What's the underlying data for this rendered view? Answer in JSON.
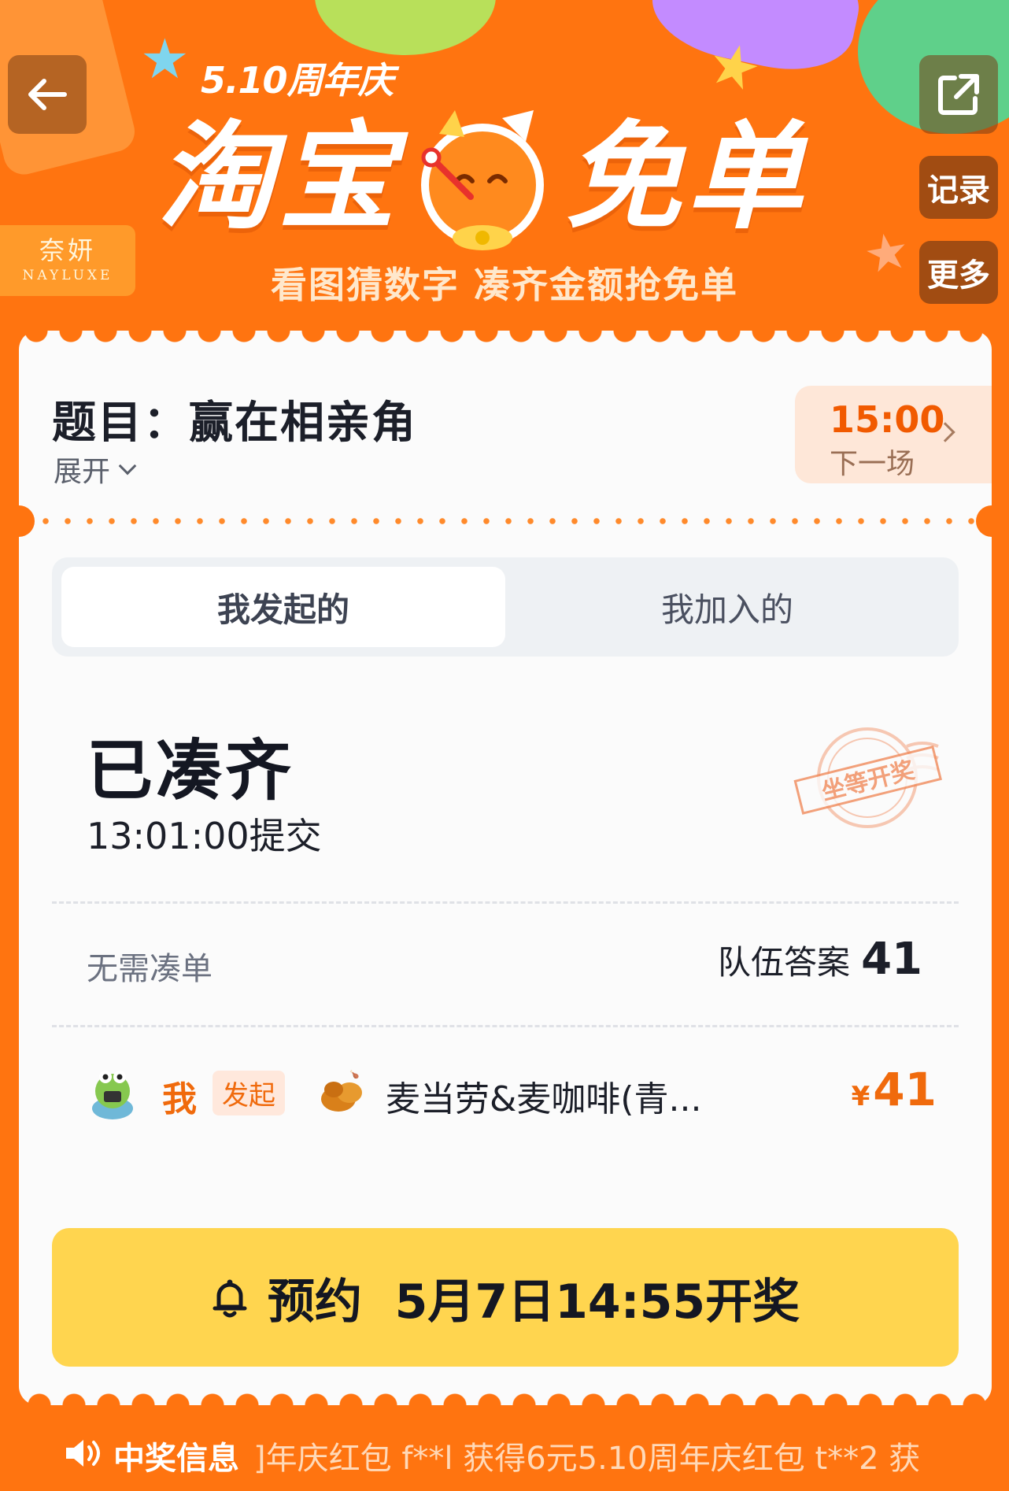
{
  "header": {
    "event_tag": "5.10周年庆",
    "title_left": "淘宝",
    "title_right": "免单",
    "subtitle": "看图猜数字 凑齐金额抢免单",
    "brand_cn": "奈妍",
    "brand_en": "NAYLUXE",
    "records_label": "记录",
    "more_label": "更多",
    "back_icon": "back-arrow-icon",
    "share_icon": "share-icon"
  },
  "question": {
    "title": "题目：赢在相亲角",
    "expand_label": "展开"
  },
  "next_session": {
    "time": "15:00",
    "label": "下一场"
  },
  "tabs": [
    {
      "label": "我发起的",
      "active": true
    },
    {
      "label": "我加入的",
      "active": false
    }
  ],
  "status": {
    "title": "已凑齐",
    "submit_time": "13:01:00提交",
    "stamp_text": "坐等开奖"
  },
  "summary": {
    "no_join_label": "无需凑单",
    "team_answer_label": "队伍答案",
    "team_answer_value": "41"
  },
  "member": {
    "name": "我",
    "tag": "发起",
    "store": "麦当劳&麦咖啡(青...",
    "currency": "¥",
    "amount": "41"
  },
  "remind_button": {
    "label": "预约  5月7日14:55开奖"
  },
  "ticker": {
    "label": "中奖信息",
    "text": "]年庆红包   f**l 获得6元5.10周年庆红包   t**2 获"
  },
  "colors": {
    "background": "#ff7410",
    "accent": "#f06a0c",
    "button": "#ffd54f"
  }
}
